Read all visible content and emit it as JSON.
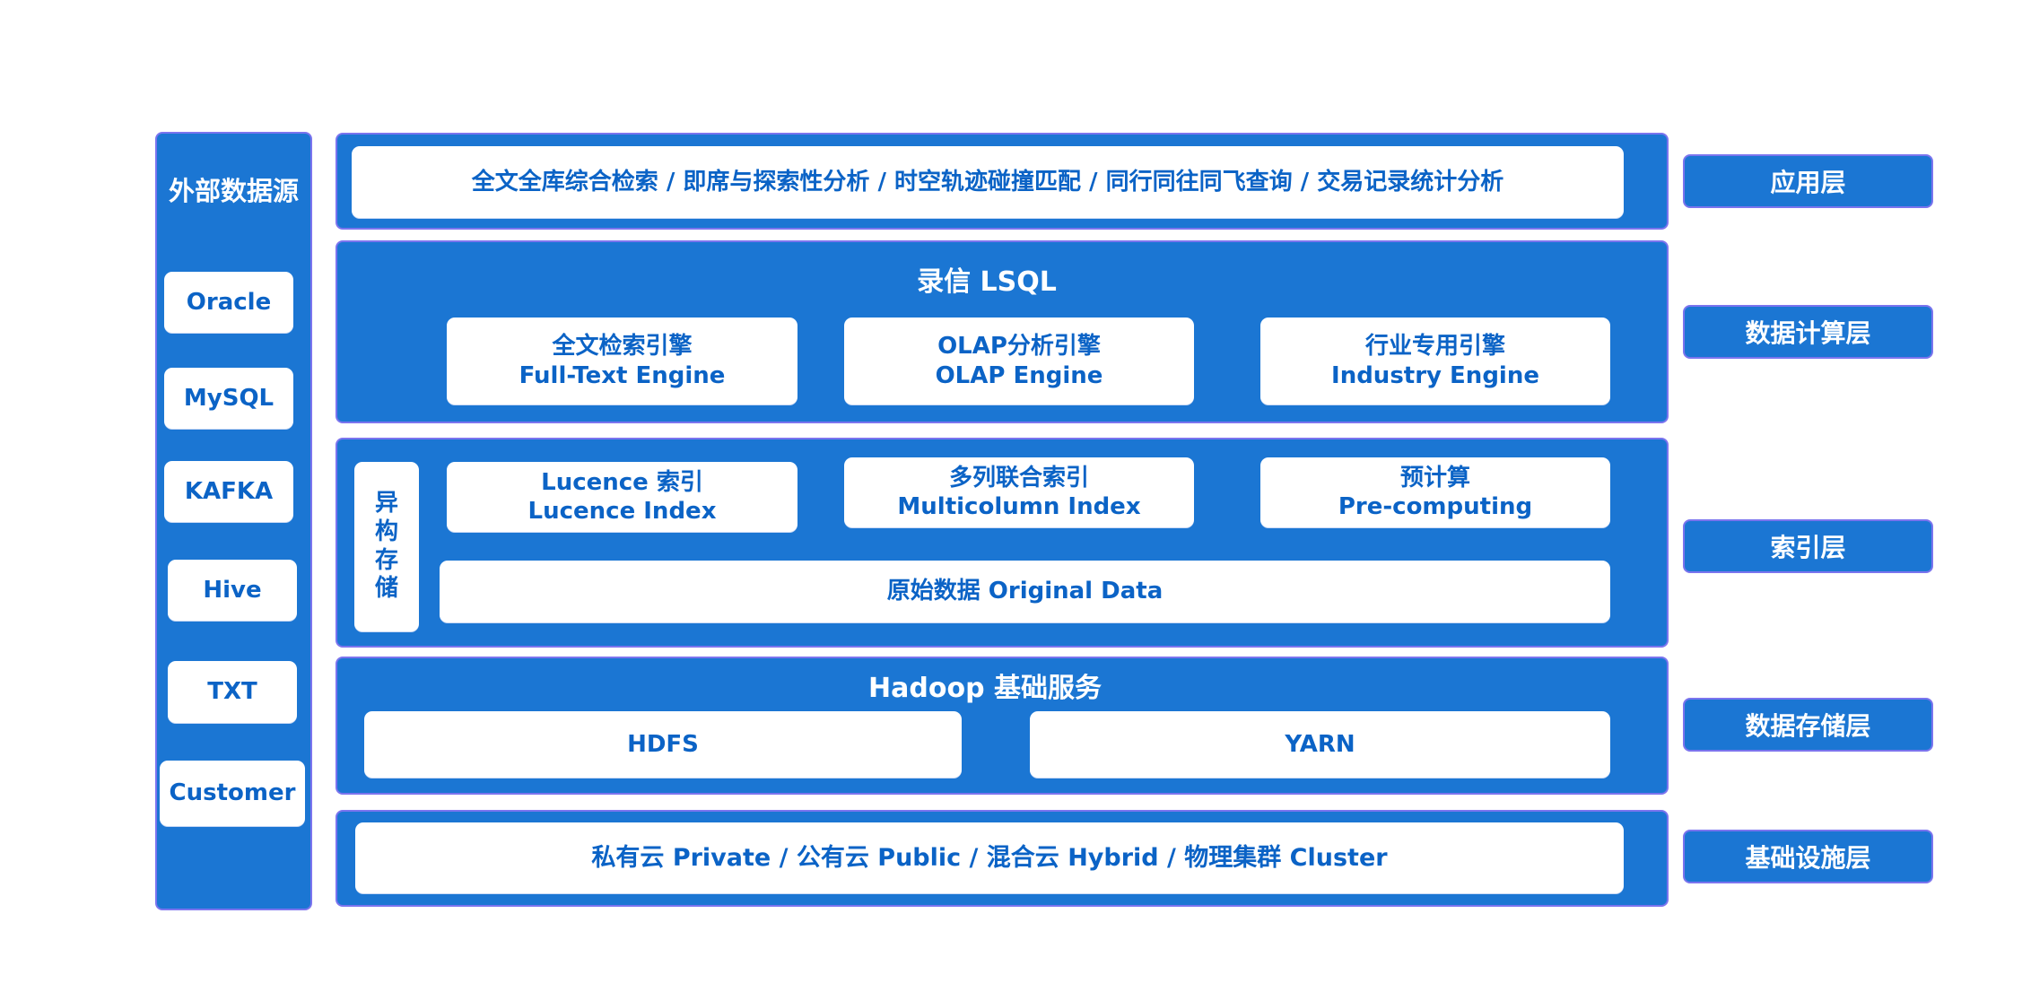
{
  "colors": {
    "panel_blue": "#1b76d3",
    "panel_border": "#7b74ee",
    "card_text": "#0b63c6",
    "card_bg": "#ffffff"
  },
  "sources": {
    "title": "外部数据源",
    "items": [
      "Oracle",
      "MySQL",
      "KAFKA",
      "Hive",
      "TXT",
      "Customer"
    ]
  },
  "application": {
    "text": "全文全库综合检索 / 即席与探索性分析 / 时空轨迹碰撞匹配 / 同行同往同飞查询 / 交易记录统计分析"
  },
  "compute": {
    "title": "录信 LSQL",
    "engines": [
      {
        "zh": "全文检索引擎",
        "en": "Full-Text Engine"
      },
      {
        "zh": "OLAP分析引擎",
        "en": "OLAP Engine"
      },
      {
        "zh": "行业专用引擎",
        "en": "Industry Engine"
      }
    ]
  },
  "index": {
    "side_label": [
      "异",
      "构",
      "存",
      "储"
    ],
    "items": [
      {
        "zh": "Lucence 索引",
        "en": "Lucence Index"
      },
      {
        "zh": "多列联合索引",
        "en": "Multicolumn Index"
      },
      {
        "zh": "预计算",
        "en": "Pre-computing"
      }
    ],
    "original_data": "原始数据 Original Data"
  },
  "storage": {
    "title": "Hadoop 基础服务",
    "items": [
      "HDFS",
      "YARN"
    ]
  },
  "infrastructure": {
    "text": "私有云 Private / 公有云 Public / 混合云 Hybrid / 物理集群 Cluster"
  },
  "layers": [
    "应用层",
    "数据计算层",
    "索引层",
    "数据存储层",
    "基础设施层"
  ]
}
